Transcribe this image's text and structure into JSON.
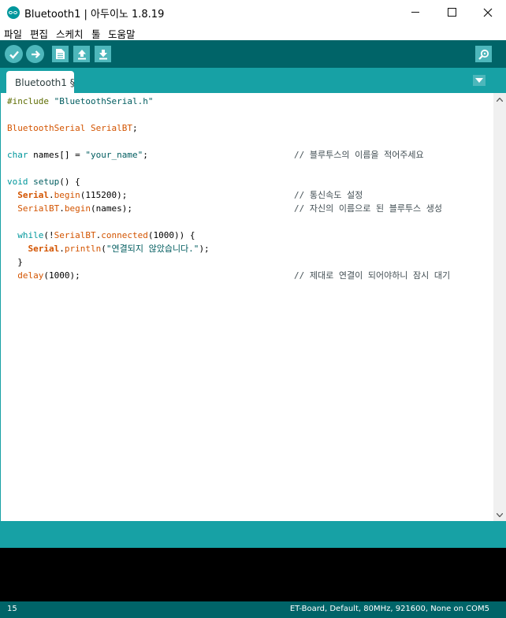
{
  "window": {
    "title": "Bluetooth1 | 아두이노 1.8.19"
  },
  "menu": [
    "파일",
    "편집",
    "스케치",
    "툴",
    "도움말"
  ],
  "toolbar": {
    "buttons": [
      "verify-icon",
      "upload-icon",
      "new-icon",
      "open-icon",
      "save-icon",
      "serial-monitor-icon"
    ]
  },
  "tab": {
    "label": "Bluetooth1 §"
  },
  "code": {
    "l1": {
      "a": "#include ",
      "b": "\"BluetoothSerial.h\""
    },
    "l3": {
      "a": "BluetoothSerial",
      "b": " ",
      "c": "SerialBT",
      "d": ";"
    },
    "l5": {
      "a": "char",
      "b": " names[] = ",
      "c": "\"your_name\"",
      "d": ";",
      "cmt": "// 블루투스의 이름을 적어주세요"
    },
    "l7": {
      "a": "void",
      "b": " ",
      "c": "setup",
      "d": "() {"
    },
    "l8": {
      "a": "  ",
      "b": "Serial",
      "c": ".",
      "d": "begin",
      "e": "(115200);",
      "cmt": "// 통신속도 설정"
    },
    "l9": {
      "a": "  ",
      "b": "SerialBT",
      "c": ".",
      "d": "begin",
      "e": "(names);",
      "cmt": "// 자신의 이름으로 된 블루투스 생성"
    },
    "l11": {
      "a": "  ",
      "b": "while",
      "c": "(!",
      "d": "SerialBT",
      "e": ".",
      "f": "connected",
      "g": "(1000)) {"
    },
    "l12": {
      "a": "    ",
      "b": "Serial",
      "c": ".",
      "d": "println",
      "e": "(",
      "f": "\"연결되지 않았습니다.\"",
      "g": ");"
    },
    "l13": {
      "a": "  }"
    },
    "l14": {
      "a": "  ",
      "b": "delay",
      "c": "(1000);",
      "cmt": "// 제대로 연결이 되어야하니 잠시 대기"
    }
  },
  "status": {
    "line_number": "15",
    "board": "ET-Board, Default, 80MHz, 921600, None on COM5"
  },
  "colors": {
    "toolbar": "#006468",
    "tabbar": "#17a1a5",
    "button": "#4db7bb",
    "keyword": "#00979c",
    "function": "#d35400"
  }
}
